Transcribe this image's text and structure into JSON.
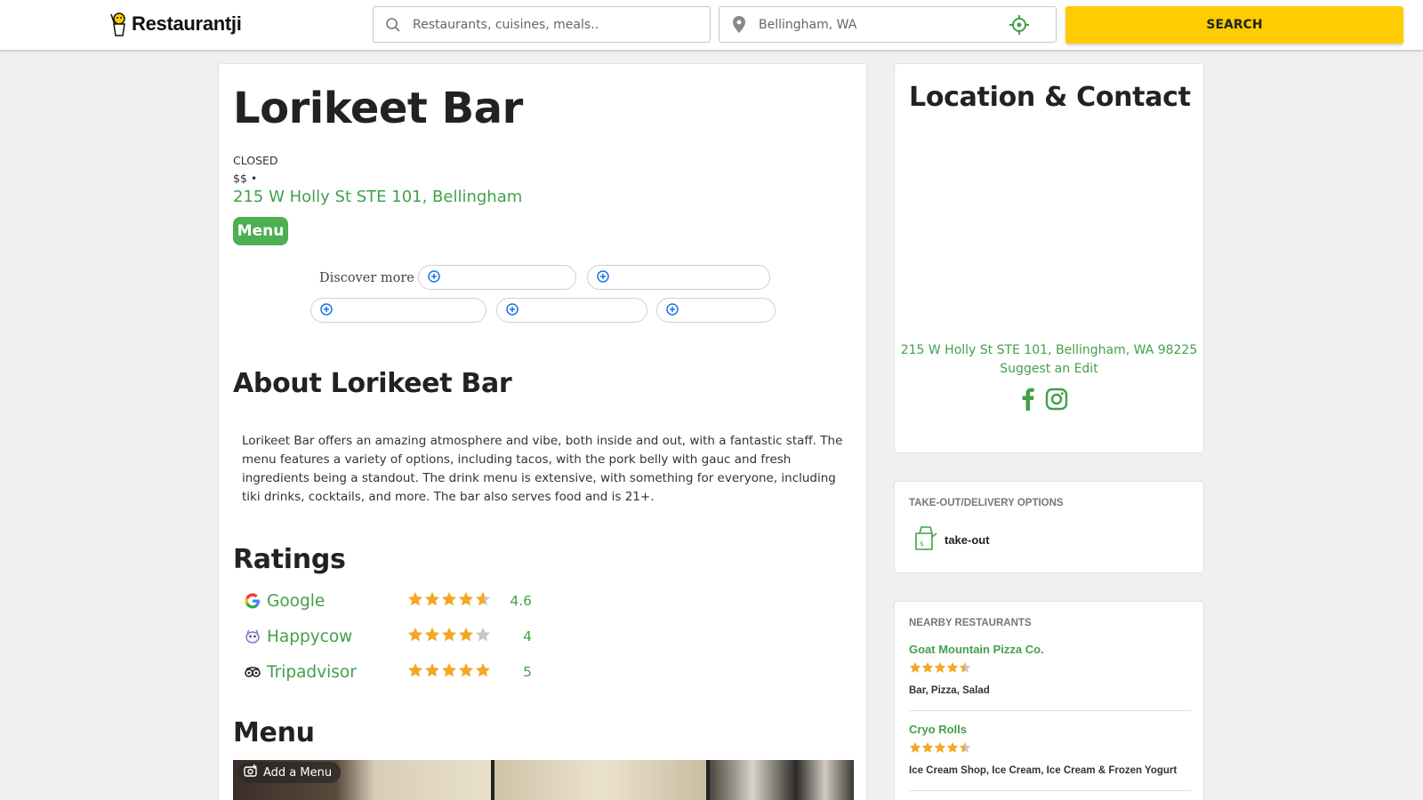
{
  "header": {
    "logo_text": "Restaurantji",
    "search_placeholder": "Restaurants, cuisines, meals..",
    "location_value": "Bellingham, WA",
    "search_label": "SEARCH"
  },
  "restaurant": {
    "name": "Lorikeet Bar",
    "status": "CLOSED",
    "price": "$$ •",
    "address": "215 W Holly St STE 101, Bellingham",
    "menu_button": "Menu",
    "discover_label": "Discover more"
  },
  "about": {
    "heading": "About Lorikeet Bar",
    "text": "Lorikeet Bar offers an amazing atmosphere and vibe, both inside and out, with a fantastic staff. The menu features a variety of options, including tacos, with the pork belly with gauc and fresh ingredients being a standout. The drink menu is extensive, with something for everyone, including tiki drinks, cocktails, and more. The bar also serves food and is 21+."
  },
  "ratings": {
    "heading": "Ratings",
    "items": [
      {
        "source": "Google",
        "value": "4.6",
        "stars": 4.6,
        "icon": "google-icon"
      },
      {
        "source": "Happycow",
        "value": "4",
        "stars": 4,
        "icon": "happycow-icon"
      },
      {
        "source": "Tripadvisor",
        "value": "5",
        "stars": 5,
        "icon": "tripadvisor-icon"
      }
    ]
  },
  "menu_section": {
    "heading": "Menu",
    "add_menu_label": "Add a Menu"
  },
  "location": {
    "heading": "Location & Contact",
    "full_address": "215 W Holly St STE 101, Bellingham, WA 98225",
    "suggest_edit": "Suggest an Edit"
  },
  "takeout": {
    "label": "TAKE-OUT/DELIVERY OPTIONS",
    "option": "take-out"
  },
  "nearby": {
    "label": "NEARBY RESTAURANTS",
    "items": [
      {
        "name": "Goat Mountain Pizza Co.",
        "stars": 4.5,
        "categories": "Bar, Pizza, Salad"
      },
      {
        "name": "Cryo Rolls",
        "stars": 4.5,
        "categories": "Ice Cream Shop, Ice Cream, Ice Cream & Frozen Yogurt"
      }
    ]
  },
  "colors": {
    "accent_green": "#43a047",
    "star_orange": "#f5a623",
    "search_yellow": "#ffcc00"
  }
}
